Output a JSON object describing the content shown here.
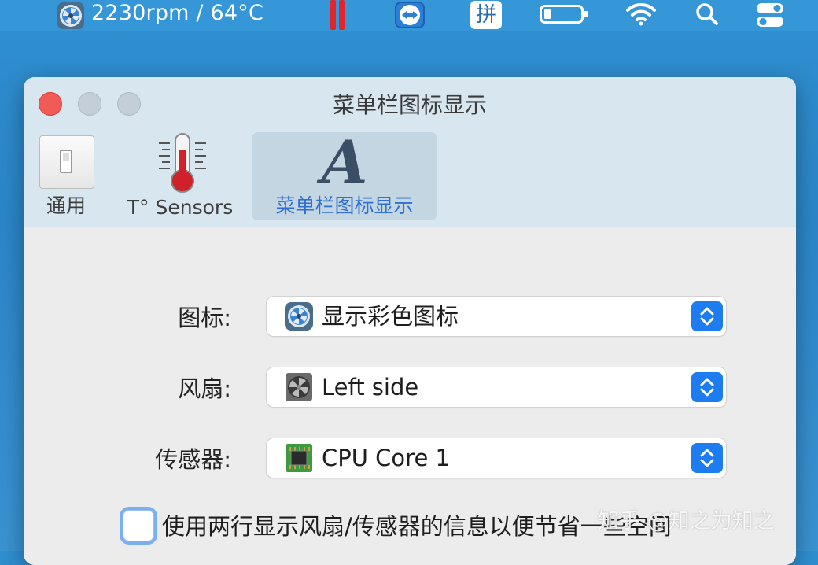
{
  "menubar": {
    "fan_status": "2230rpm / 64°C",
    "input_method": "拼",
    "icons": [
      "fan-control-icon",
      "red-bars-icon",
      "teamviewer-icon",
      "pinyin-input-icon",
      "battery-icon",
      "wifi-icon",
      "search-icon",
      "control-center-icon"
    ]
  },
  "window": {
    "title": "菜单栏图标显示",
    "tabs": [
      {
        "label": "通用",
        "icon": "switch-icon"
      },
      {
        "label": "T° Sensors",
        "icon": "thermometer-icon"
      },
      {
        "label": "菜单栏图标显示",
        "icon": "letter-a-icon",
        "selected": true
      }
    ]
  },
  "form": {
    "icon_label": "图标:",
    "icon_value": "显示彩色图标",
    "fan_label": "风扇:",
    "fan_value": "Left side",
    "sensor_label": "传感器:",
    "sensor_value": "CPU Core 1",
    "two_line_label": "使用两行显示风扇/传感器的信息以便节省一些空间",
    "two_line_checked": false
  },
  "watermark": "知乎 @知之为知之",
  "colors": {
    "accent": "#1c7cf0",
    "close": "#f25b55",
    "menubar": "#3597d8"
  }
}
